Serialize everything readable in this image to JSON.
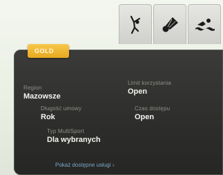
{
  "tabs": [
    {
      "icon": "gymnast-icon"
    },
    {
      "icon": "shuttlecock-icon"
    },
    {
      "icon": "swimmer-icon"
    }
  ],
  "panel": {
    "badge": "GOLD",
    "fields": {
      "region": {
        "label": "Region",
        "value": "Mazowsze"
      },
      "usage_limit": {
        "label": "Limit korzystania",
        "value": "Open"
      },
      "duration": {
        "label": "Długość umowy",
        "value": "Rok"
      },
      "access_time": {
        "label": "Czas dostępu",
        "value": "Open"
      },
      "multisport_type": {
        "label": "Typ MultiSport",
        "value": "Dla wybranych"
      }
    },
    "link": "Pokaż dostępne usługi ›"
  },
  "colors": {
    "badge": "#e7a91e",
    "panel": "#2e2e2c",
    "link": "#79a6c7"
  }
}
